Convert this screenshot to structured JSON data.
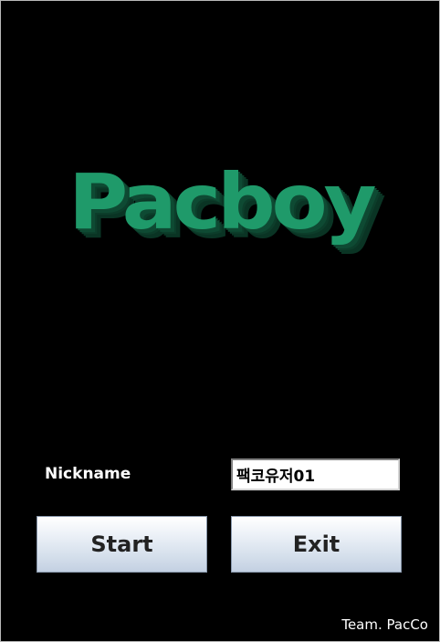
{
  "logo": {
    "text": "Pacboy",
    "color": "#1f9a6a",
    "shadow_color": "#0e4a33"
  },
  "form": {
    "nickname_label": "Nickname",
    "nickname_value": "팩코유저01"
  },
  "buttons": {
    "start_label": "Start",
    "exit_label": "Exit"
  },
  "footer": {
    "team": "Team. PacCo"
  }
}
